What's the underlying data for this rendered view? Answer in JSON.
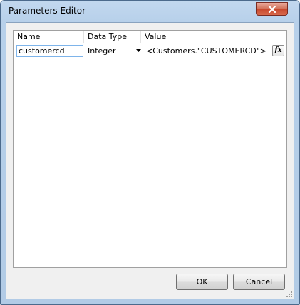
{
  "window": {
    "title": "Parameters Editor"
  },
  "grid": {
    "columns": [
      "Name",
      "Data Type",
      "Value"
    ],
    "rows": [
      {
        "name": "customercd",
        "data_type": "Integer",
        "value": "<Customers.\"CUSTOMERCD\">",
        "expr_button": "fx"
      }
    ]
  },
  "buttons": {
    "ok": "OK",
    "cancel": "Cancel"
  },
  "colors": {
    "frame": "#b7d0ea",
    "close": "#c7462b",
    "input_focus_border": "#7eb4ea"
  },
  "icons": [
    "close-icon",
    "dropdown-arrow-icon",
    "fx-icon",
    "resize-grip-icon"
  ]
}
